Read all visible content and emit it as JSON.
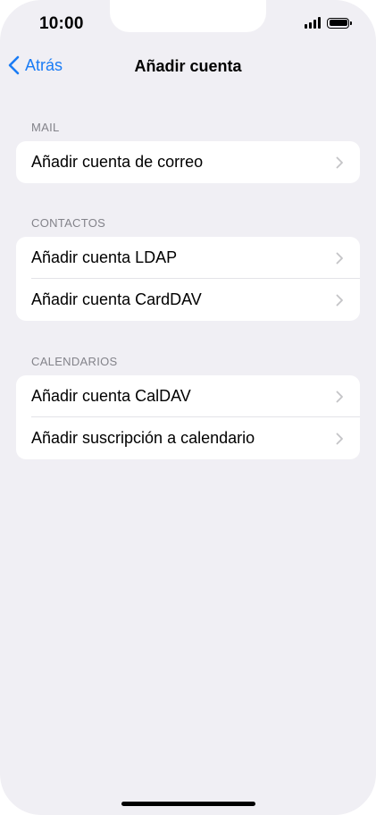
{
  "status_bar": {
    "time": "10:00",
    "signal_icon": "cellular-signal-icon",
    "battery_icon": "battery-full-icon"
  },
  "nav": {
    "back_label": "Atrás",
    "back_icon": "chevron-left-icon",
    "title": "Añadir cuenta",
    "accent_color": "#1a7cf5"
  },
  "sections": [
    {
      "header": "MAIL",
      "rows": [
        {
          "label": "Añadir cuenta de correo"
        }
      ]
    },
    {
      "header": "CONTACTOS",
      "rows": [
        {
          "label": "Añadir cuenta LDAP"
        },
        {
          "label": "Añadir cuenta CardDAV"
        }
      ]
    },
    {
      "header": "CALENDARIOS",
      "rows": [
        {
          "label": "Añadir cuenta CalDAV"
        },
        {
          "label": "Añadir suscripción a calendario"
        }
      ]
    }
  ],
  "row_chevron_icon": "chevron-right-icon",
  "colors": {
    "background": "#f0eff4",
    "card": "#ffffff",
    "section_header": "#83838a"
  }
}
